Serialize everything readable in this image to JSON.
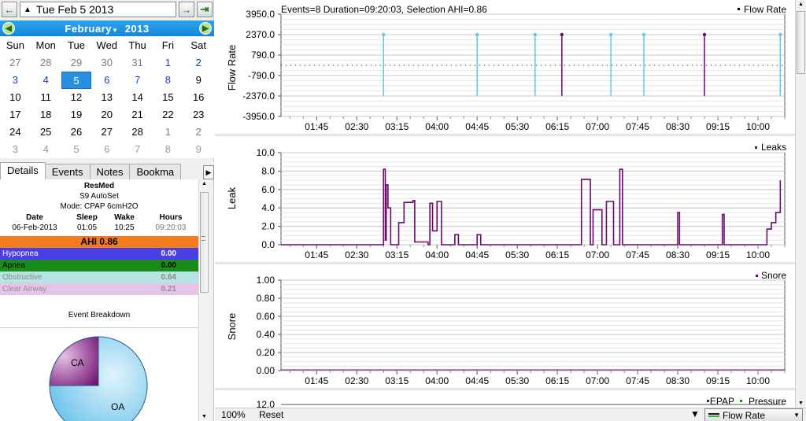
{
  "datebar": {
    "prev_icon": "arrow-left",
    "date_text": "Tue Feb 5 2013",
    "next_icon": "arrow-right",
    "last_icon": "arrow-to-end"
  },
  "calendar": {
    "month": "February",
    "year": "2013",
    "weekdays": [
      "Sun",
      "Mon",
      "Tue",
      "Wed",
      "Thu",
      "Fri",
      "Sat"
    ],
    "weeks": [
      [
        {
          "d": "27",
          "s": "other"
        },
        {
          "d": "28",
          "s": "other"
        },
        {
          "d": "29",
          "s": "other"
        },
        {
          "d": "30",
          "s": "other"
        },
        {
          "d": "31",
          "s": "other"
        },
        {
          "d": "1",
          "s": "blue"
        },
        {
          "d": "2",
          "s": "blue"
        }
      ],
      [
        {
          "d": "3",
          "s": "blue"
        },
        {
          "d": "4",
          "s": "blue"
        },
        {
          "d": "5",
          "s": "sel"
        },
        {
          "d": "6",
          "s": "blue"
        },
        {
          "d": "7",
          "s": "blue"
        },
        {
          "d": "8",
          "s": "blue"
        },
        {
          "d": "9",
          "s": ""
        }
      ],
      [
        {
          "d": "10",
          "s": ""
        },
        {
          "d": "11",
          "s": ""
        },
        {
          "d": "12",
          "s": ""
        },
        {
          "d": "13",
          "s": ""
        },
        {
          "d": "14",
          "s": ""
        },
        {
          "d": "15",
          "s": ""
        },
        {
          "d": "16",
          "s": ""
        }
      ],
      [
        {
          "d": "17",
          "s": ""
        },
        {
          "d": "18",
          "s": ""
        },
        {
          "d": "19",
          "s": ""
        },
        {
          "d": "20",
          "s": ""
        },
        {
          "d": "21",
          "s": ""
        },
        {
          "d": "22",
          "s": ""
        },
        {
          "d": "23",
          "s": ""
        }
      ],
      [
        {
          "d": "24",
          "s": ""
        },
        {
          "d": "25",
          "s": ""
        },
        {
          "d": "26",
          "s": ""
        },
        {
          "d": "27",
          "s": ""
        },
        {
          "d": "28",
          "s": ""
        },
        {
          "d": "1",
          "s": "other"
        },
        {
          "d": "2",
          "s": "other"
        }
      ],
      [
        {
          "d": "3",
          "s": "faint"
        },
        {
          "d": "4",
          "s": "faint"
        },
        {
          "d": "5",
          "s": "faint"
        },
        {
          "d": "6",
          "s": "faint"
        },
        {
          "d": "7",
          "s": "faint"
        },
        {
          "d": "8",
          "s": "faint"
        },
        {
          "d": "9",
          "s": "faint"
        }
      ]
    ]
  },
  "tabs": [
    "Details",
    "Events",
    "Notes",
    "Bookma"
  ],
  "details": {
    "brand": "ResMed",
    "model": "S9 AutoSet",
    "mode": "Mode: CPAP 6cmH2O",
    "headers": [
      "Date",
      "Sleep",
      "Wake",
      "Hours"
    ],
    "values": [
      "06-Feb-2013",
      "01:05",
      "10:25",
      "09:20:03"
    ],
    "ahi": "AHI 0.86",
    "events": [
      {
        "label": "Hypopnea",
        "value": "0.00",
        "bg": "#4a3ee6",
        "fg": "#ffffff"
      },
      {
        "label": "Apnea",
        "value": "0.00",
        "bg": "#1a8c1a",
        "fg": "#000000"
      },
      {
        "label": "Obstructive",
        "value": "0.64",
        "bg": "#b6e4e4",
        "fg": "#8a8a8a"
      },
      {
        "label": "Clear Airway",
        "value": "0.21",
        "bg": "#e6c4e6",
        "fg": "#9a8a9a"
      }
    ],
    "breakdown_title": "Event Breakdown",
    "pie_labels": [
      "CA",
      "OA"
    ]
  },
  "graphs": {
    "flow": {
      "header": "Events=8 Duration=09:20:03, Selection AHI=0.86",
      "ylabel": "Flow Rate",
      "legend": "Flow Rate",
      "yticks": [
        "3950.0",
        "2370.0",
        "790.0",
        "-790.0",
        "-2370.0",
        "-3950.0"
      ]
    },
    "leaks": {
      "ylabel": "Leak",
      "legend": "Leaks",
      "yticks": [
        "10.0",
        "8.0",
        "6.0",
        "4.0",
        "2.0",
        "0.0"
      ]
    },
    "snore": {
      "ylabel": "Snore",
      "legend": "Snore",
      "yticks": [
        "1.00",
        "0.80",
        "0.60",
        "0.40",
        "0.20",
        "0.00"
      ]
    },
    "pressure": {
      "legend1": "EPAP",
      "legend2": "Pressure",
      "ytick_partial": "12.0"
    },
    "xticks": [
      "01:45",
      "02:30",
      "03:15",
      "04:00",
      "04:45",
      "05:30",
      "06:15",
      "07:00",
      "07:45",
      "08:30",
      "09:15",
      "10:00"
    ]
  },
  "chart_data": [
    {
      "type": "line",
      "title": "Events=8 Duration=09:20:03, Selection AHI=0.86",
      "ylabel": "Flow Rate",
      "ylim": [
        -3950,
        3950
      ],
      "series": [
        {
          "name": "Flow Rate",
          "values": [
            0
          ]
        }
      ],
      "event_flags": [
        {
          "time": "03:00",
          "kind": "OA"
        },
        {
          "time": "04:45",
          "kind": "OA"
        },
        {
          "time": "05:50",
          "kind": "OA"
        },
        {
          "time": "06:20",
          "kind": "CA"
        },
        {
          "time": "07:15",
          "kind": "OA"
        },
        {
          "time": "07:52",
          "kind": "OA"
        },
        {
          "time": "09:00",
          "kind": "CA"
        },
        {
          "time": "10:25",
          "kind": "OA"
        }
      ]
    },
    {
      "type": "line",
      "ylabel": "Leak",
      "ylim": [
        0,
        10
      ],
      "series": [
        {
          "name": "Leaks",
          "points": [
            [
              "01:05",
              0
            ],
            [
              "02:57",
              0
            ],
            [
              "03:00",
              8.2
            ],
            [
              "03:02",
              0.5
            ],
            [
              "03:03",
              6.5
            ],
            [
              "03:05",
              4
            ],
            [
              "03:08",
              0
            ],
            [
              "03:13",
              0
            ],
            [
              "03:17",
              2.4
            ],
            [
              "03:23",
              4.6
            ],
            [
              "03:33",
              4.8
            ],
            [
              "03:35",
              0.3
            ],
            [
              "03:50",
              0
            ],
            [
              "03:52",
              4.5
            ],
            [
              "03:55",
              1.5
            ],
            [
              "04:00",
              4.7
            ],
            [
              "04:05",
              0
            ],
            [
              "04:20",
              1.1
            ],
            [
              "04:24",
              0
            ],
            [
              "04:45",
              1.1
            ],
            [
              "04:49",
              0
            ],
            [
              "06:38",
              0
            ],
            [
              "06:42",
              7.1
            ],
            [
              "06:46",
              7.1
            ],
            [
              "06:50",
              7.1
            ],
            [
              "06:52",
              0
            ],
            [
              "06:55",
              3.8
            ],
            [
              "07:05",
              0
            ],
            [
              "07:10",
              4.7
            ],
            [
              "07:18",
              0
            ],
            [
              "07:25",
              8.2
            ],
            [
              "07:28",
              0
            ],
            [
              "08:30",
              3.5
            ],
            [
              "08:32",
              0
            ],
            [
              "09:20",
              3.3
            ],
            [
              "09:22",
              0
            ],
            [
              "10:10",
              1.7
            ],
            [
              "10:15",
              2.4
            ],
            [
              "10:20",
              3.5
            ],
            [
              "10:25",
              7.0
            ]
          ]
        }
      ]
    },
    {
      "type": "line",
      "ylabel": "Snore",
      "ylim": [
        0,
        1
      ],
      "series": [
        {
          "name": "Snore",
          "values": [
            0
          ]
        }
      ]
    }
  ],
  "bottom": {
    "zoom": "100%",
    "reset": "Reset",
    "graph_select": "Flow Rate"
  }
}
